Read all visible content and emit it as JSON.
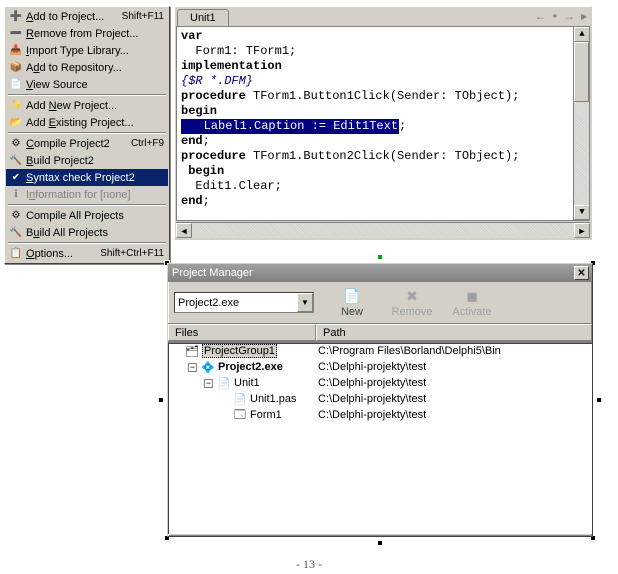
{
  "menu": {
    "items": [
      {
        "icon": "➕",
        "label_html": "<u>A</u>dd to Project...",
        "shortcut": "Shift+F11"
      },
      {
        "icon": "➖",
        "label_html": "<u>R</u>emove from Project..."
      },
      {
        "icon": "📥",
        "label_html": "<u>I</u>mport Type Library..."
      },
      {
        "icon": "📦",
        "label_html": "A<u>d</u>d to Repository..."
      },
      {
        "icon": "📄",
        "label_html": "<u>V</u>iew Source"
      },
      {
        "sep": true
      },
      {
        "icon": "✨",
        "label_html": "Add <u>N</u>ew Project..."
      },
      {
        "icon": "📂",
        "label_html": "Add <u>E</u>xisting Project..."
      },
      {
        "sep": true
      },
      {
        "icon": "⚙",
        "label_html": "<u>C</u>ompile Project2",
        "shortcut": "Ctrl+F9"
      },
      {
        "icon": "🔨",
        "label_html": "<u>B</u>uild Project2"
      },
      {
        "icon": "✔",
        "label_html": "<u>S</u>yntax check Project2",
        "selected": true
      },
      {
        "icon": "ℹ",
        "label_html": "I<u>n</u>formation for [none]",
        "disabled": true
      },
      {
        "sep": true
      },
      {
        "icon": "⚙",
        "label_html": "Compile All Projects"
      },
      {
        "icon": "🔨",
        "label_html": "B<u>u</u>ild All Projects"
      },
      {
        "sep": true
      },
      {
        "icon": "📋",
        "label_html": "<u>O</u>ptions...",
        "shortcut": "Shift+Ctrl+F11"
      }
    ]
  },
  "editor": {
    "tab": "Unit1",
    "nav_left": "←",
    "nav_bullet": "•",
    "nav_right": "→",
    "nav_submenu": "▸",
    "lines": [
      {
        "t": "var",
        "kw": true
      },
      {
        "t": "  Form1: TForm1;"
      },
      {
        "t": "implementation",
        "kw": true
      },
      {
        "t": "{$R *.DFM}",
        "cm": true
      },
      {
        "proc1a": "procedure",
        "proc1b": " TForm1.Button1Click(Sender: TObject);"
      },
      {
        "t": "begin",
        "kw": true
      },
      {
        "sel": "   Label1.Caption := Edit1Text",
        "after": ";"
      },
      {
        "t": "end;",
        "kw_end": true
      },
      {
        "t": ""
      },
      {
        "proc2a": "procedure",
        "proc2b": " TForm1.Button2Click(Sender: TObject);"
      },
      {
        "t": " begin",
        "kw": true
      },
      {
        "t": "  Edit1.Clear;"
      },
      {
        "t": "end;",
        "kw_end": true
      }
    ]
  },
  "projman": {
    "title": "Project Manager",
    "combo": "Project2.exe",
    "btn_new": "New",
    "btn_remove": "Remove",
    "btn_activate": "Activate",
    "col_files": "Files",
    "col_path": "Path",
    "rows": [
      {
        "depth": 0,
        "toggle": "",
        "ico": "🗂",
        "label": "ProjectGroup1",
        "path": "C:\\Program Files\\Borland\\Delphi5\\Bin",
        "sel": true
      },
      {
        "depth": 1,
        "toggle": "−",
        "ico": "💠",
        "label": "Project2.exe",
        "path": "C:\\Delphi-projekty\\test",
        "bold": true
      },
      {
        "depth": 2,
        "toggle": "−",
        "ico": "📄",
        "label": "Unit1",
        "path": "C:\\Delphi-projekty\\test"
      },
      {
        "depth": 3,
        "toggle": "",
        "ico": "📄",
        "label": "Unit1.pas",
        "path": "C:\\Delphi-projekty\\test"
      },
      {
        "depth": 3,
        "toggle": "",
        "ico": "🗔",
        "label": "Form1",
        "path": "C:\\Delphi-projekty\\test"
      }
    ]
  },
  "pagenum": "- 13 -"
}
